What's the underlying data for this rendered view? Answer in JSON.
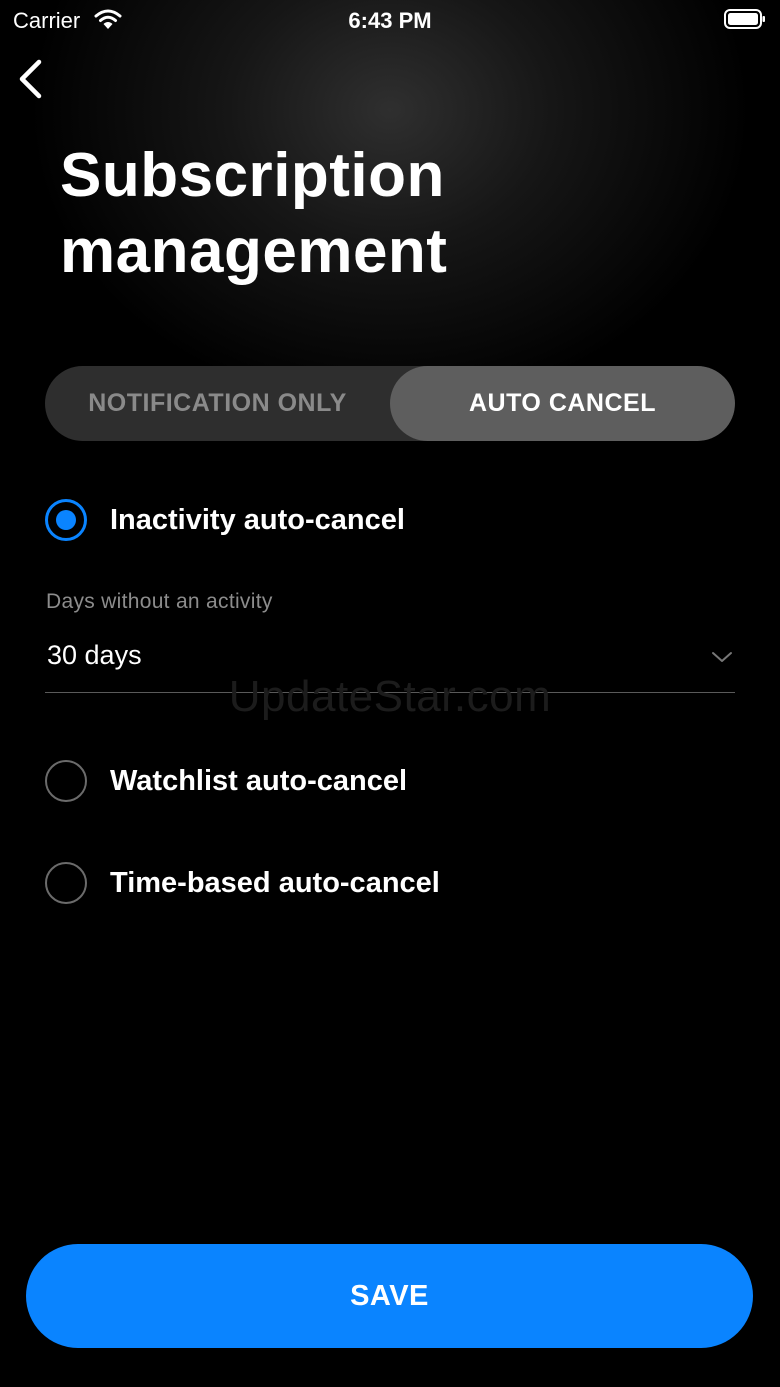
{
  "status_bar": {
    "carrier": "Carrier",
    "time": "6:43 PM",
    "icons": [
      "wifi-icon",
      "battery-icon"
    ]
  },
  "header": {
    "back_icon": "chevron-left-icon",
    "title_line1": "Subscription",
    "title_line2": "management"
  },
  "mode_toggle": {
    "options": [
      {
        "label": "NOTIFICATION ONLY",
        "selected": false
      },
      {
        "label": "AUTO CANCEL",
        "selected": true
      }
    ]
  },
  "options": [
    {
      "label": "Inactivity auto-cancel",
      "selected": true
    },
    {
      "label": "Watchlist auto-cancel",
      "selected": false
    },
    {
      "label": "Time-based auto-cancel",
      "selected": false
    }
  ],
  "inactivity_field": {
    "label": "Days without an activity",
    "value": "30 days",
    "icon": "chevron-down-icon"
  },
  "watermark": "UpdateStar.com",
  "save_label": "SAVE",
  "colors": {
    "accent": "#0a84ff",
    "background": "#000000",
    "segment_track": "#2e2e2e",
    "segment_active": "#5e5e5e"
  }
}
